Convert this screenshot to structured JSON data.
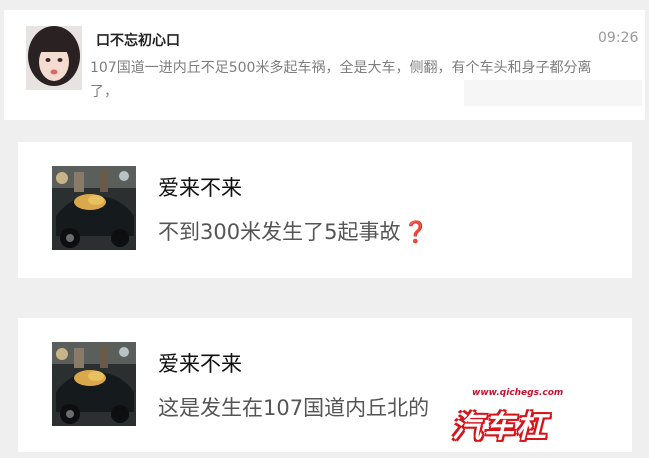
{
  "conversation": {
    "header": {
      "name": "口不忘初心口",
      "time": "09:26",
      "message": "107国道一进内丘不足500米多起车祸，全是大车，侧翻，有个车头和身子都分离了，"
    },
    "replies": [
      {
        "name": "爱来不来",
        "message": "不到300米发生了5起事故",
        "emoji": "❓"
      },
      {
        "name": "爱来不来",
        "message": "这是发生在107国道内丘北的"
      }
    ]
  },
  "watermark": {
    "url": "www.qichegs.com",
    "logo": "汽车杠"
  }
}
